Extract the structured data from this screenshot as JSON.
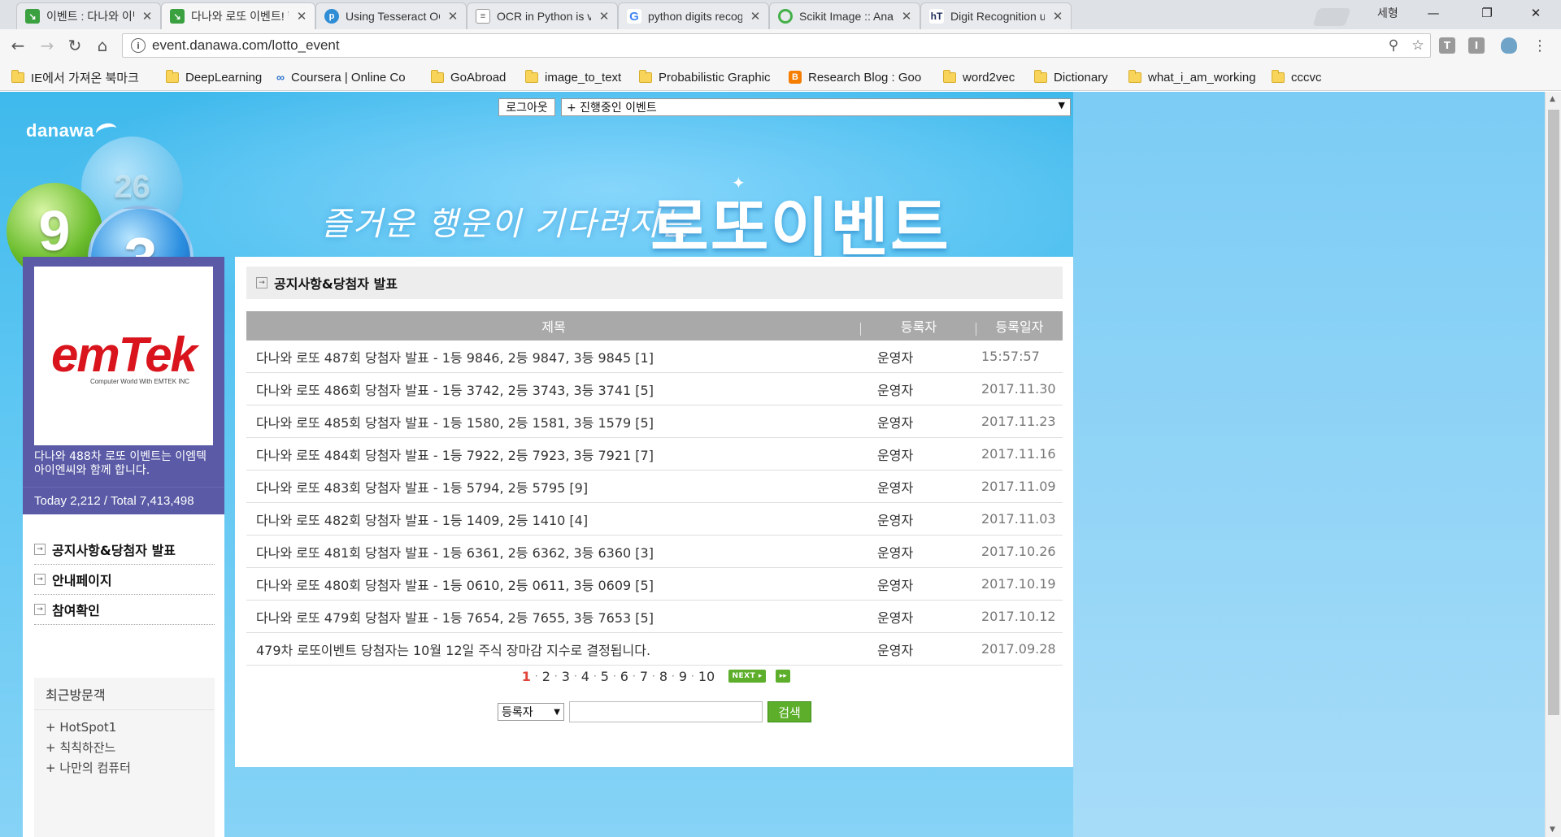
{
  "browser": {
    "tabs": [
      {
        "title": "이벤트 : 다나와 이벤트",
        "favicon": "danawa-icon",
        "color": "#3aa040"
      },
      {
        "title": "다나와 로또 이벤트! 행",
        "favicon": "danawa-icon",
        "color": "#3aa040",
        "active": true
      },
      {
        "title": "Using Tesseract OCR w",
        "favicon": "p-icon",
        "color": "#2f8dd6"
      },
      {
        "title": "OCR in Python is very",
        "favicon": "page-icon",
        "color": "#888888"
      },
      {
        "title": "python digits recogniti",
        "favicon": "google-icon",
        "color": "#4285f4"
      },
      {
        "title": "Scikit Image :: Anacon",
        "favicon": "anaconda-icon",
        "color": "#43b049"
      },
      {
        "title": "Digit Recognition usin",
        "favicon": "ht-icon",
        "color": "#1e2a5a"
      }
    ],
    "profile_name": "세형",
    "address": "event.danawa.com/lotto_event",
    "bookmarks": [
      {
        "label": "IE에서 가져온 북마크",
        "icon": "folder-icon"
      },
      {
        "label": "DeepLearning",
        "icon": "folder-icon"
      },
      {
        "label": "Coursera | Online Co",
        "icon": "coursera-icon"
      },
      {
        "label": "GoAbroad",
        "icon": "folder-icon"
      },
      {
        "label": "image_to_text",
        "icon": "folder-icon"
      },
      {
        "label": "Probabilistic Graphic",
        "icon": "folder-icon"
      },
      {
        "label": "Research Blog : Goo",
        "icon": "blogger-icon"
      },
      {
        "label": "word2vec",
        "icon": "folder-icon"
      },
      {
        "label": "Dictionary",
        "icon": "folder-icon"
      },
      {
        "label": "what_i_am_working",
        "icon": "folder-icon"
      },
      {
        "label": "cccvc",
        "icon": "folder-icon"
      }
    ]
  },
  "header": {
    "logout_label": "로그아웃",
    "event_select_value": "+ 진행중인 이벤트",
    "logo_text": "danawa",
    "ball_numbers": [
      "9",
      "3",
      "26"
    ],
    "slogan": "즐거운 행운이 기다려지는",
    "event_title": "로또이벤트"
  },
  "sidebar": {
    "promo_logo": "emTek",
    "promo_sub": "Computer World With EMTEK INC",
    "promo_text": "다나와 488차 로또 이벤트는 이엠텍아이엔씨와 함께 합니다.",
    "counter": "Today 2,212 / Total 7,413,498",
    "menu": [
      {
        "label": "공지사항&당첨자 발표"
      },
      {
        "label": "안내페이지"
      },
      {
        "label": "참여확인"
      }
    ],
    "recent_title": "최근방문객",
    "recent_visitors": [
      "+ HotSpot1",
      "+ 칙칙하잔느",
      "+ 나만의 컴퓨터"
    ]
  },
  "main": {
    "section_title": "공지사항&당첨자 발표",
    "columns": {
      "title": "제목",
      "author": "등록자",
      "date": "등록일자"
    },
    "rows": [
      {
        "title": "다나와 로또 487회 당첨자 발표 - 1등 9846, 2등 9847, 3등 9845 [1]",
        "author": "운영자",
        "date": "15:57:57"
      },
      {
        "title": "다나와 로또 486회 당첨자 발표 - 1등 3742, 2등 3743, 3등 3741 [5]",
        "author": "운영자",
        "date": "2017.11.30"
      },
      {
        "title": "다나와 로또 485회 당첨자 발표 - 1등 1580, 2등 1581, 3등 1579 [5]",
        "author": "운영자",
        "date": "2017.11.23"
      },
      {
        "title": "다나와 로또 484회 당첨자 발표 - 1등 7922, 2등 7923, 3등 7921 [7]",
        "author": "운영자",
        "date": "2017.11.16"
      },
      {
        "title": "다나와 로또 483회 당첨자 발표 - 1등 5794, 2등 5795 [9]",
        "author": "운영자",
        "date": "2017.11.09"
      },
      {
        "title": "다나와 로또 482회 당첨자 발표 - 1등 1409, 2등 1410 [4]",
        "author": "운영자",
        "date": "2017.11.03"
      },
      {
        "title": "다나와 로또 481회 당첨자 발표 - 1등 6361, 2등 6362, 3등 6360 [3]",
        "author": "운영자",
        "date": "2017.10.26"
      },
      {
        "title": "다나와 로또 480회 당첨자 발표 - 1등 0610, 2등 0611, 3등 0609 [5]",
        "author": "운영자",
        "date": "2017.10.19"
      },
      {
        "title": "다나와 로또 479회 당첨자 발표 - 1등 7654, 2등 7655, 3등 7653 [5]",
        "author": "운영자",
        "date": "2017.10.12"
      },
      {
        "title": "479차 로또이벤트 당첨자는 10월 12일 주식 장마감 지수로 결정됩니다.",
        "author": "운영자",
        "date": "2017.09.28"
      }
    ],
    "pages": [
      "1",
      "2",
      "3",
      "4",
      "5",
      "6",
      "7",
      "8",
      "9",
      "10"
    ],
    "current_page": "1",
    "next_label": "NEXT",
    "search_field_value": "등록자",
    "search_button_label": "검색"
  }
}
